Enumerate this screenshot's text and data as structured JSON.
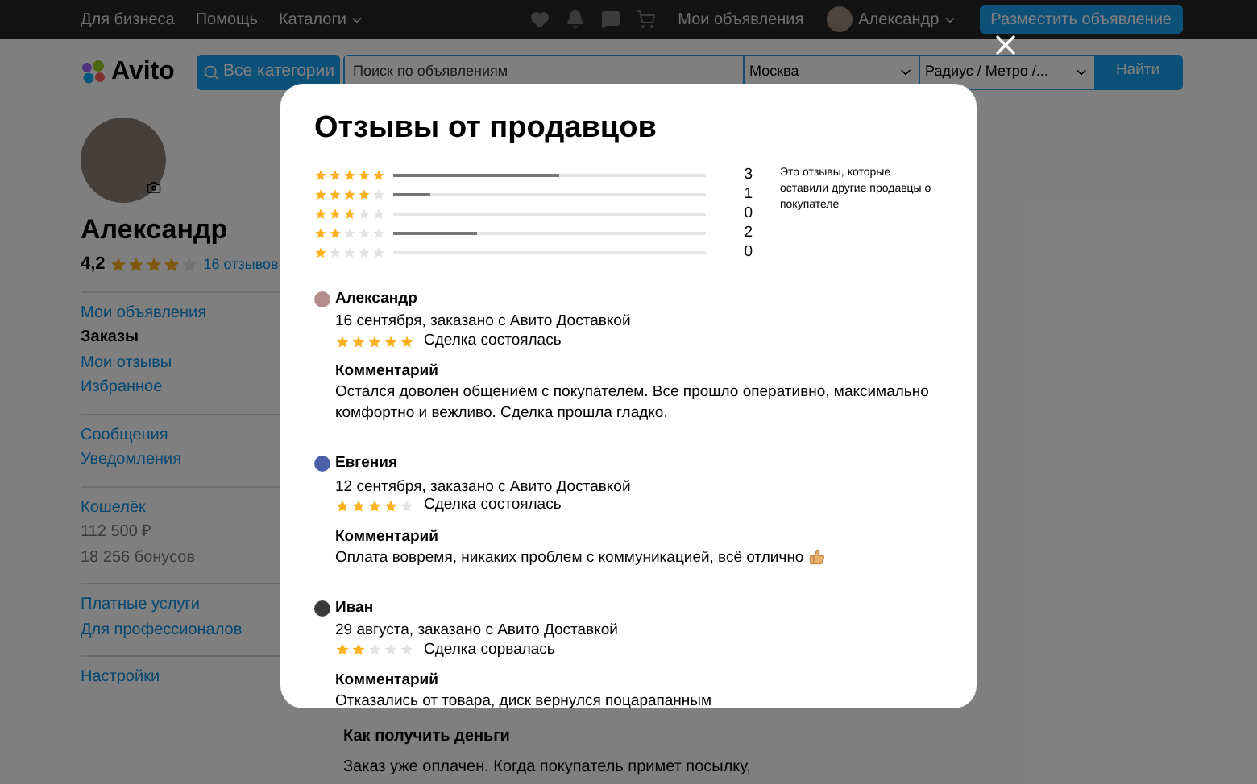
{
  "top_bar": {
    "links": [
      {
        "label": "Для бизнеса",
        "dropdown": false
      },
      {
        "label": "Помощь",
        "dropdown": false
      },
      {
        "label": "Каталоги",
        "dropdown": true
      }
    ],
    "my_ads": "Мои объявления",
    "user": "Александр",
    "post_button": "Разместить объявление"
  },
  "search_bar": {
    "logo": "Avito",
    "categories_button": "Все категории",
    "placeholder": "Поиск по объявлениям",
    "city": "Москва",
    "radius": "Радиус / Метро /...",
    "search_button": "Найти"
  },
  "profile": {
    "name": "Александр",
    "rating": "4,2",
    "stars": 4,
    "reviews_link": "16 отзывов"
  },
  "sidebar": {
    "groups": [
      [
        {
          "label": "Мои объявления",
          "kind": "link"
        },
        {
          "label": "Заказы",
          "kind": "active"
        },
        {
          "label": "Мои отзывы",
          "kind": "link"
        },
        {
          "label": "Избранное",
          "kind": "link"
        }
      ],
      [
        {
          "label": "Сообщения",
          "kind": "link"
        },
        {
          "label": "Уведомления",
          "kind": "link"
        }
      ],
      [
        {
          "label": "Кошелёк",
          "kind": "link"
        },
        {
          "label": "112 500 ₽",
          "kind": "muted"
        },
        {
          "label": "18 256 бонусов",
          "kind": "muted"
        }
      ],
      [
        {
          "label": "Платные услуги",
          "kind": "link"
        },
        {
          "label": "Для профессионалов",
          "kind": "link"
        }
      ],
      [
        {
          "label": "Настройки",
          "kind": "link"
        }
      ]
    ]
  },
  "order_info": {
    "heading": "Как получить деньги",
    "text": "Заказ уже оплачен. Когда покупатель примет посылку,"
  },
  "modal": {
    "title": "Отзывы от продавцов",
    "breakdown": [
      {
        "stars": 5,
        "level": 0.53,
        "count": "3"
      },
      {
        "stars": 4,
        "level": 0.12,
        "count": "1"
      },
      {
        "stars": 3,
        "level": 0,
        "count": "0"
      },
      {
        "stars": 2,
        "level": 0.27,
        "count": "2"
      },
      {
        "stars": 1,
        "level": 0,
        "count": "0"
      }
    ],
    "note": "Это отзывы, которые оставили другие продавцы о покупателе",
    "reviews": [
      {
        "author": "Александр",
        "color": "#b58c8c",
        "meta": "16 сентября, заказано с Авито Доставкой",
        "stars": 5,
        "outcome": "Сделка состоялась",
        "comment_heading": "Комментарий",
        "comment": "Остался доволен общением с покупателем. Все прошло оперативно, максимально комфортно и вежливо. Сделка прошла гладко.",
        "thumbs_up": false
      },
      {
        "author": "Евгения",
        "color": "#4a5fa8",
        "meta": "12 сентября, заказано с Авито Доставкой",
        "stars": 4,
        "outcome": "Сделка состоялась",
        "comment_heading": "Комментарий",
        "comment": "Оплата вовремя, никаких проблем с коммуникацией, всё отлично",
        "thumbs_up": true
      },
      {
        "author": "Иван",
        "color": "#3a3a3a",
        "meta": "29 августа, заказано с Авито Доставкой",
        "stars": 2,
        "outcome": "Сделка сорвалась",
        "comment_heading": "Комментарий",
        "comment": "Отказались от товара, диск вернулся поцарапанным",
        "thumbs_up": false
      }
    ]
  }
}
